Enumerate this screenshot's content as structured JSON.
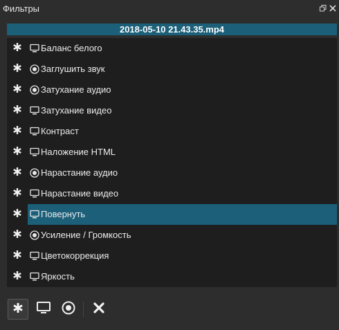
{
  "window": {
    "title": "Фильтры",
    "float_icon": "float-icon",
    "close_icon": "close-icon"
  },
  "clip": {
    "filename": "2018-05-10 21.43.35.mp4"
  },
  "colors": {
    "selection": "#1b5f79",
    "list_bg": "#1e1e1e",
    "panel_bg": "#2d2d2d"
  },
  "filters": [
    {
      "label": "Баланс белого",
      "kind": "video",
      "icon": "monitor-icon",
      "favorite_icon": "asterisk-icon",
      "selected": false
    },
    {
      "label": "Заглушить звук",
      "kind": "audio",
      "icon": "speaker-icon",
      "favorite_icon": "asterisk-icon",
      "selected": false
    },
    {
      "label": "Затухание аудио",
      "kind": "audio",
      "icon": "speaker-icon",
      "favorite_icon": "asterisk-icon",
      "selected": false
    },
    {
      "label": "Затухание видео",
      "kind": "video",
      "icon": "monitor-icon",
      "favorite_icon": "asterisk-icon",
      "selected": false
    },
    {
      "label": "Контраст",
      "kind": "video",
      "icon": "monitor-icon",
      "favorite_icon": "asterisk-icon",
      "selected": false
    },
    {
      "label": "Наложение HTML",
      "kind": "video",
      "icon": "monitor-icon",
      "favorite_icon": "asterisk-icon",
      "selected": false
    },
    {
      "label": "Нарастание аудио",
      "kind": "audio",
      "icon": "speaker-icon",
      "favorite_icon": "asterisk-icon",
      "selected": false
    },
    {
      "label": "Нарастание видео",
      "kind": "video",
      "icon": "monitor-icon",
      "favorite_icon": "asterisk-icon",
      "selected": false
    },
    {
      "label": "Повернуть",
      "kind": "video",
      "icon": "monitor-icon",
      "favorite_icon": "asterisk-icon",
      "selected": true
    },
    {
      "label": "Усиление / Громкость",
      "kind": "audio",
      "icon": "speaker-icon",
      "favorite_icon": "asterisk-icon",
      "selected": false
    },
    {
      "label": "Цветокоррекция",
      "kind": "video",
      "icon": "monitor-icon",
      "favorite_icon": "asterisk-icon",
      "selected": false
    },
    {
      "label": "Яркость",
      "kind": "video",
      "icon": "monitor-icon",
      "favorite_icon": "asterisk-icon",
      "selected": false
    }
  ],
  "toolbar": {
    "favorites_icon": "asterisk-icon",
    "video_icon": "monitor-icon",
    "audio_icon": "speaker-icon",
    "close_icon": "close-x-icon",
    "active": "favorites"
  }
}
